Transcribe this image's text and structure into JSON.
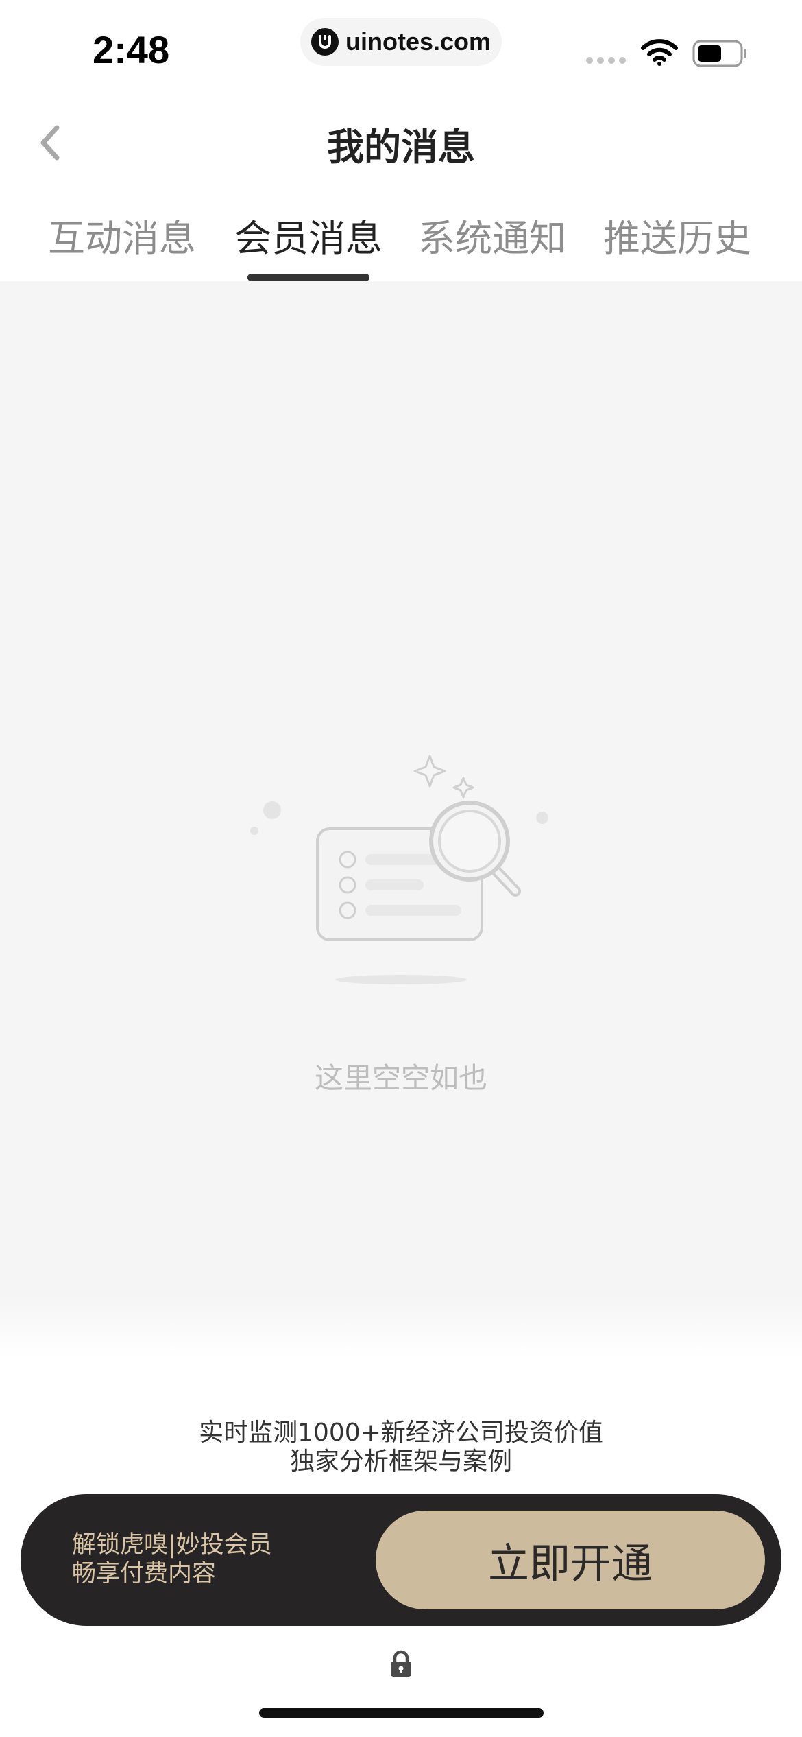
{
  "status_bar": {
    "time": "2:48",
    "url": "uinotes.com",
    "icons": [
      "signal-icon",
      "wifi-icon",
      "battery-icon"
    ]
  },
  "nav": {
    "title": "我的消息",
    "back_icon": "chevron-left-icon"
  },
  "tabs": [
    {
      "label": "互动消息",
      "active": false
    },
    {
      "label": "会员消息",
      "active": true
    },
    {
      "label": "系统通知",
      "active": false
    },
    {
      "label": "推送历史",
      "active": false
    }
  ],
  "empty_state": {
    "icon": "empty-search-illustration",
    "text": "这里空空如也"
  },
  "membership": {
    "lock_icon": "lock-icon",
    "line1": "实时监测1000+新经济公司投资价值",
    "line2": "独家分析框架与案例",
    "bar_line1": "解锁虎嗅|妙投会员",
    "bar_line2": "畅享付费内容",
    "button_label": "立即开通"
  },
  "colors": {
    "accent_gold": "#cdbb9e",
    "bar_dark": "#262424",
    "bar_text": "#d9c5a5",
    "background": "#f5f5f5"
  }
}
